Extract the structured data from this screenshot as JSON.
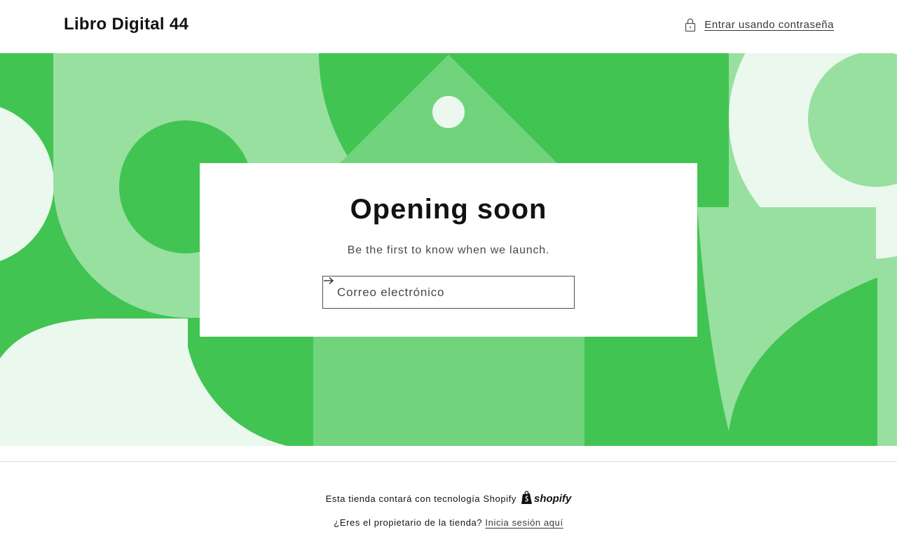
{
  "header": {
    "store_name": "Libro Digital 44",
    "login_label": "Entrar usando contraseña",
    "login_icon": "lock-icon"
  },
  "main": {
    "title": "Opening soon",
    "subtitle": "Be the first to know when we launch.",
    "email_placeholder": "Correo electrónico",
    "submit_icon": "arrow-right-icon"
  },
  "footer": {
    "powered_by": "Esta tienda contará con tecnología Shopify",
    "shopify_wordmark": "shopify",
    "owner_question": "¿Eres el propietario de la tienda?",
    "owner_login_link": "Inicia sesión aquí"
  },
  "colors": {
    "green_dark": "#42c453",
    "green_mid": "#71d47d",
    "green_light": "#98e0a0",
    "green_pale": "#ebf8ed",
    "text": "#121212"
  }
}
